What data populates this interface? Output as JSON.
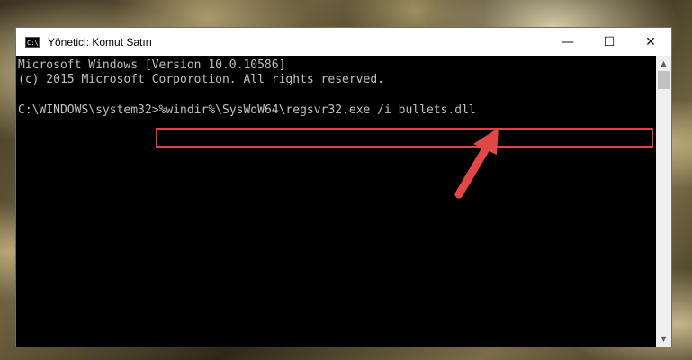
{
  "window": {
    "title": "Yönetici: Komut Satırı",
    "icon_label": "C:\\",
    "controls": {
      "minimize": "—",
      "maximize": "☐",
      "close": "✕"
    }
  },
  "console": {
    "line1": "Microsoft Windows [Version 10.0.10586]",
    "line2": "(c) 2015 Microsoft Corporotion. All rights reserved.",
    "prompt": "C:\\WINDOWS\\system32>",
    "command": "%windir%\\SysWoW64\\regsvr32.exe /i bullets.dll"
  },
  "colors": {
    "highlight": "#e53f3f",
    "console_text": "#c0c0c0",
    "console_bg": "#000000"
  },
  "icons": [
    "cmd-app-icon",
    "minimize-icon",
    "maximize-icon",
    "close-icon",
    "scroll-up-icon",
    "scroll-down-icon",
    "annotation-arrow"
  ]
}
